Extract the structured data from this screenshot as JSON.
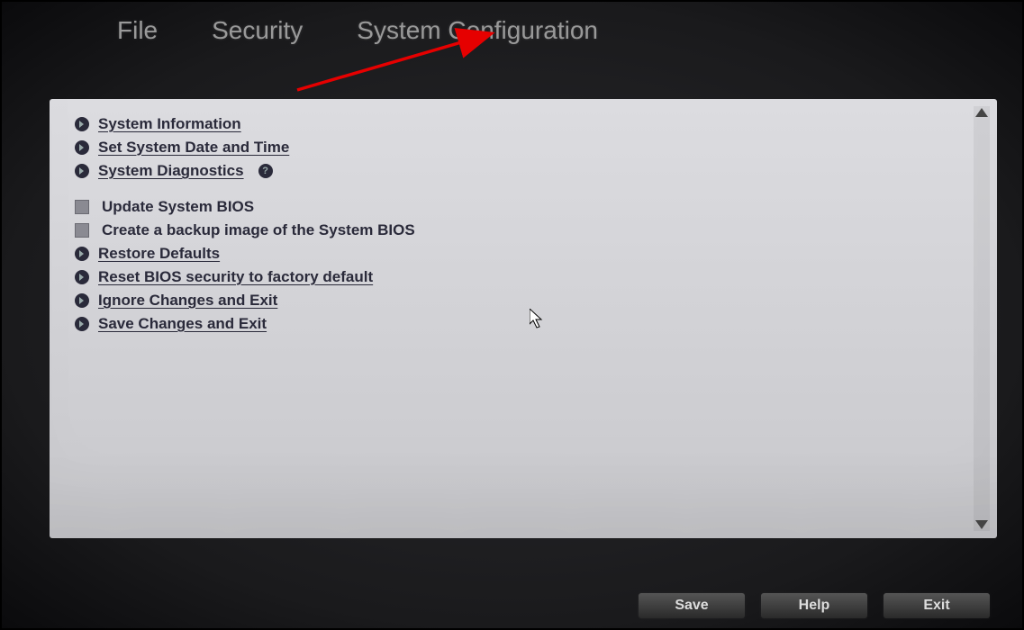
{
  "menu": {
    "file": "File",
    "security": "Security",
    "system_config": "System Configuration"
  },
  "items": [
    {
      "bullet": "arrow",
      "style": "link",
      "label": "System Information",
      "help": false
    },
    {
      "bullet": "arrow",
      "style": "link",
      "label": "Set System Date and Time",
      "help": false
    },
    {
      "bullet": "arrow",
      "style": "link",
      "label": "System Diagnostics",
      "help": true
    },
    {
      "separator": true
    },
    {
      "bullet": "square",
      "style": "plain",
      "label": "Update System BIOS",
      "help": false
    },
    {
      "bullet": "square",
      "style": "plain",
      "label": "Create a backup image of the System BIOS",
      "help": false
    },
    {
      "bullet": "arrow",
      "style": "link",
      "label": "Restore Defaults",
      "help": false
    },
    {
      "bullet": "arrow",
      "style": "link",
      "label": "Reset BIOS security to factory default",
      "help": false
    },
    {
      "bullet": "arrow",
      "style": "link",
      "label": "Ignore Changes and Exit",
      "help": false
    },
    {
      "bullet": "arrow",
      "style": "link",
      "label": "Save Changes and Exit",
      "help": false
    }
  ],
  "buttons": {
    "save": "Save",
    "help": "Help",
    "exit": "Exit"
  }
}
